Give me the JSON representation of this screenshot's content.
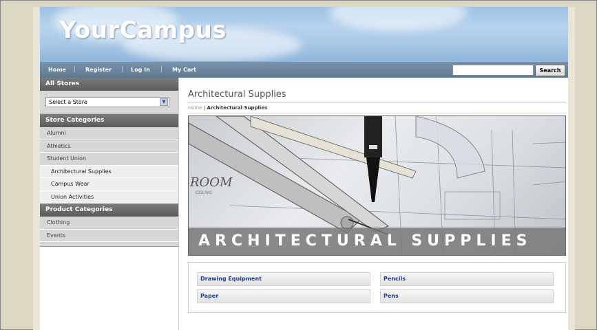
{
  "site": {
    "logo": "YourCampus"
  },
  "nav": {
    "home": "Home",
    "register": "Register",
    "login": "Log In",
    "cart": "My Cart",
    "separator": "|",
    "search_placeholder": "",
    "search_button": "Search"
  },
  "sidebar": {
    "all_stores_heading": "All Stores",
    "store_select_value": "Select a Store",
    "store_categories_heading": "Store Categories",
    "store_categories": [
      "Alumni",
      "Athletics",
      "Student Union",
      "Architectural Supplies",
      "Campus Wear",
      "Union Activities"
    ],
    "product_categories_heading": "Product Categories",
    "product_categories": [
      "Clothing",
      "Events"
    ]
  },
  "main": {
    "page_title": "Architectural Supplies",
    "breadcrumb": {
      "home": "Home",
      "separator": " | ",
      "current": "Architectural Supplies"
    },
    "banner": {
      "caption": "ARCHITECTURAL SUPPLIES",
      "drawing_text": "ROOM",
      "drawing_subtext": "CEILING"
    },
    "categories": [
      "Drawing Equipment",
      "Pencils",
      "Paper",
      "Pens"
    ]
  },
  "colors": {
    "link": "#1e3c8c",
    "nav_bar": "#6a839c",
    "side_header": "#6a6a6a"
  }
}
